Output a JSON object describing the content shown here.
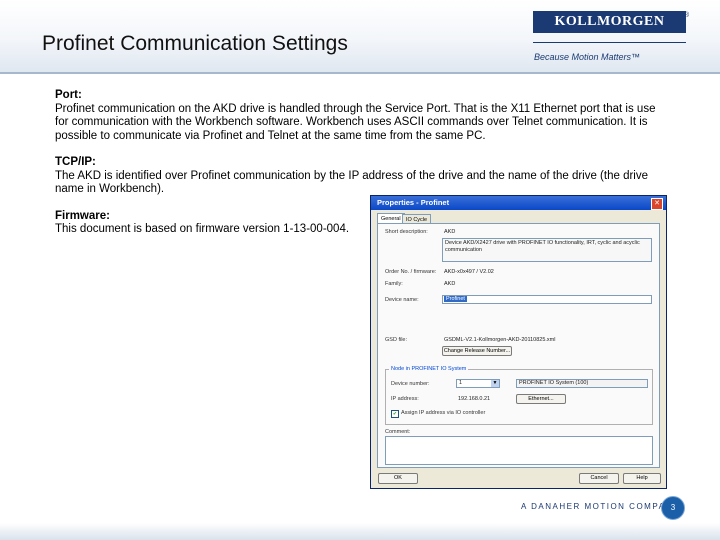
{
  "header": {
    "title": "Profinet Communication Settings"
  },
  "logo": {
    "brand": "KOLLMORGEN",
    "registered": "®",
    "tagline": "Because Motion Matters™"
  },
  "content": {
    "port_heading": "Port:",
    "port_text": "Profinet communication on the AKD drive is handled through the Service Port.  That is the X11 Ethernet port that is use for communication with the Workbench software.  Workbench uses ASCII commands over Telnet communication.  It is possible to communicate via Profinet and Telnet at the same time from the same PC.",
    "tcpip_heading": "TCP/IP:",
    "tcpip_text": "The AKD is identified over Profinet communication by the IP address of the drive and the name of the drive (the drive name in Workbench).",
    "firmware_heading": "Firmware:",
    "firmware_text": "This document is based on firmware version 1-13-00-004."
  },
  "dialog": {
    "title": "Properties - Profinet",
    "close": "✕",
    "tabs": [
      "General",
      "IO Cycle"
    ],
    "short_description_label": "Short description:",
    "short_description_value": "AKD",
    "description_value": "Device AKD/X2427 drive with PROFINET IO functionality, IRT, cyclic and acyclic communication",
    "order_label": "Order No. / firmware:",
    "order_value": "AKD-x0x497 / V2.02",
    "family_label": "Family:",
    "family_value": "AKD",
    "device_name_label": "Device name:",
    "device_name_value": "Profinet",
    "gsd_label": "GSD file:",
    "gsd_value": "GSDML-V2.1-Kollmorgen-AKD-20110825.xml",
    "change_release_button": "Change Release Number...",
    "node_group_title": "Node in PROFINET IO System",
    "device_number_label": "Device number:",
    "device_number_value": "1",
    "io_system_value": "PROFINET IO System (100)",
    "ip_label": "IP address:",
    "ip_value": "192.168.0.21",
    "ethernet_button": "Ethernet...",
    "assign_ip_checkbox": "Assign IP address via IO controller",
    "comment_label": "Comment:",
    "ok_button": "OK",
    "cancel_button": "Cancel",
    "help_button": "Help"
  },
  "footer": {
    "company": "A DANAHER MOTION COMPANY",
    "page_number": "3"
  }
}
